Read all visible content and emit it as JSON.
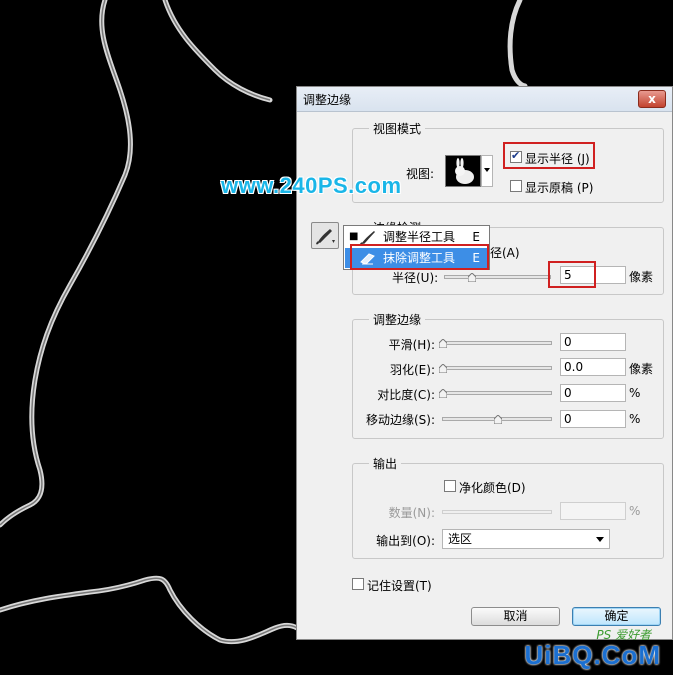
{
  "overlay": {
    "watermark": "www.240PS.com",
    "logo_text": "UiBQ.CoM",
    "logo_sub": "PS 爱好者"
  },
  "dialog": {
    "title": "调整边缘",
    "close_label": "x",
    "view_mode": {
      "group_title": "视图模式",
      "view_label": "视图:",
      "show_radius_label": "显示半径 (J)",
      "show_radius_checked": true,
      "show_original_label": "显示原稿 (P)",
      "show_original_checked": false
    },
    "edge_detection": {
      "group_title": "边缘检测",
      "smart_radius_label": "径(A)",
      "radius_label": "半径(U):",
      "radius_value": "5",
      "radius_unit": "像素"
    },
    "adjust_edge": {
      "group_title": "调整边缘",
      "rows": [
        {
          "label": "平滑(H):",
          "value": "0",
          "unit": ""
        },
        {
          "label": "羽化(E):",
          "value": "0.0",
          "unit": "像素"
        },
        {
          "label": "对比度(C):",
          "value": "0",
          "unit": "%"
        },
        {
          "label": "移动边缘(S):",
          "value": "0",
          "unit": "%"
        }
      ]
    },
    "output": {
      "group_title": "输出",
      "decontaminate_label": "净化颜色(D)",
      "decontaminate_checked": false,
      "amount_label": "数量(N):",
      "amount_unit": "%",
      "output_to_label": "输出到(O):",
      "output_to_value": "选区"
    },
    "remember_label": "记住设置(T)",
    "remember_checked": false,
    "cancel_label": "取消",
    "ok_label": "确定"
  },
  "tool_popup": {
    "items": [
      {
        "label": "调整半径工具",
        "key": "E",
        "selected": false,
        "bullet": "■"
      },
      {
        "label": "抹除调整工具",
        "key": "E",
        "selected": true,
        "bullet": ""
      }
    ]
  },
  "colors": {
    "highlight_box": "#d02020",
    "selection_blue": "#3d8ee6",
    "watermark": "#1ab6e8"
  }
}
